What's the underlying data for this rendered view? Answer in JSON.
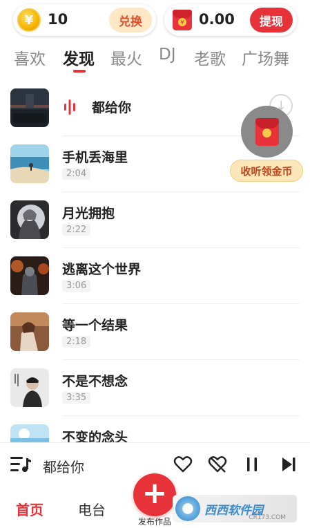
{
  "wallet": {
    "coins": "10",
    "exchange_label": "兑换",
    "cash": "0.00",
    "withdraw_label": "提现"
  },
  "tabs": [
    {
      "label": "喜欢",
      "active": false
    },
    {
      "label": "发现",
      "active": true
    },
    {
      "label": "最火",
      "active": false
    },
    {
      "label": "DJ",
      "active": false
    },
    {
      "label": "老歌",
      "active": false
    },
    {
      "label": "广场舞",
      "active": false
    }
  ],
  "songs": [
    {
      "title": "都给你",
      "duration": "",
      "playing": true,
      "cover": "dark-stage"
    },
    {
      "title": "手机丢海里",
      "duration": "2:04",
      "playing": false,
      "cover": "beach"
    },
    {
      "title": "月光拥抱",
      "duration": "2:22",
      "playing": false,
      "cover": "moon-girl"
    },
    {
      "title": "逃离这个世界",
      "duration": "3:06",
      "playing": false,
      "cover": "fire-figure"
    },
    {
      "title": "等一个结果",
      "duration": "2:18",
      "playing": false,
      "cover": "sitting-girl"
    },
    {
      "title": "不是不想念",
      "duration": "3:35",
      "playing": false,
      "cover": "singer-portrait"
    },
    {
      "title": "不变的念头",
      "duration": "",
      "playing": false,
      "cover": "sky"
    }
  ],
  "float_reward": {
    "label": "收听领金币"
  },
  "player": {
    "now_playing": "都给你"
  },
  "bottom_nav": {
    "home": "首页",
    "radio": "电台",
    "publish": "发布作品"
  },
  "watermark": {
    "text": "西西软件园",
    "sub": "CR173.COM"
  },
  "colors": {
    "accent": "#e63238",
    "coin": "#f5b400",
    "badge_bg": "#fbe7b8"
  }
}
